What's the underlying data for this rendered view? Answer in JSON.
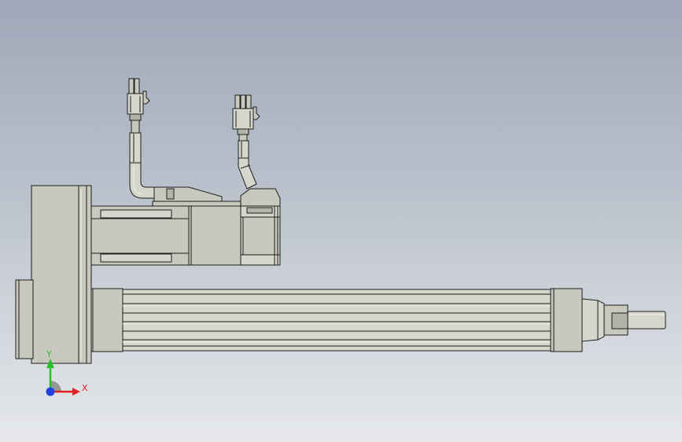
{
  "triad": {
    "x_label": "X",
    "y_label": "Y",
    "colors": {
      "x": "#e02020",
      "y": "#22c022",
      "z": "#2040e0"
    }
  },
  "model": {
    "part_color": "#c8c8be",
    "background_top": "#9ea8b8",
    "background_bottom": "#e6e8ea"
  }
}
